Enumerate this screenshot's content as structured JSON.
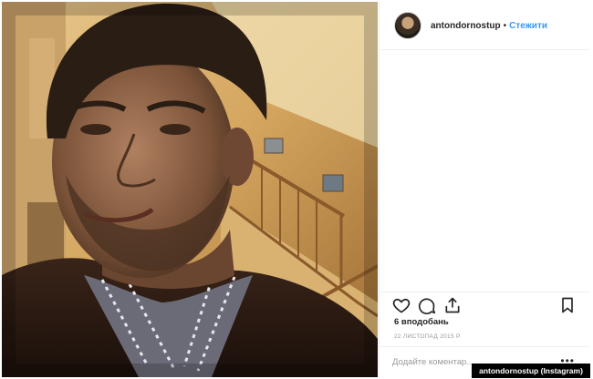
{
  "post": {
    "username": "antondornostup",
    "separator": "•",
    "follow_label": "Стежити",
    "likes_text": "6 вподобань",
    "date_text": "22 ЛИСТОПАД 2015 Р.",
    "comment_placeholder": "Додайте коментар...",
    "more_label": "•••"
  },
  "photo": {
    "description_icon": "selfie-photo"
  },
  "icons": {
    "like": "heart-icon",
    "comment": "comment-icon",
    "share": "share-icon",
    "save": "bookmark-icon"
  },
  "caption": {
    "text": "antondornostup (Instagram)"
  },
  "colors": {
    "follow": "#3897f0",
    "text": "#262626",
    "muted": "#999999",
    "caption_bg": "#000000"
  }
}
